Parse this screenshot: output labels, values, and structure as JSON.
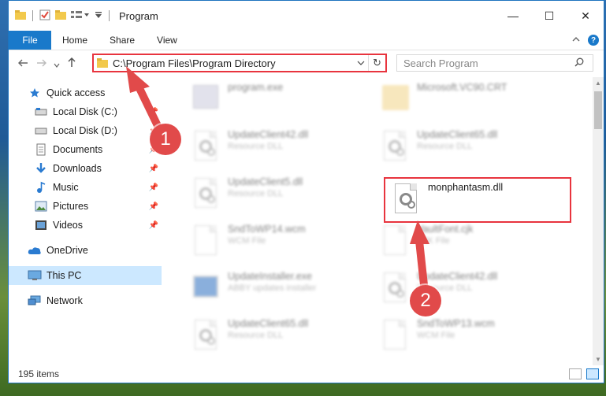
{
  "window": {
    "title": "Program",
    "controls": {
      "minimize": "—",
      "maximize": "☐",
      "close": "✕"
    }
  },
  "ribbon": {
    "file_tab": "File",
    "tabs": [
      "Home",
      "Share",
      "View"
    ]
  },
  "address_bar": {
    "path": "C:\\Program Files\\Program Directory"
  },
  "search": {
    "placeholder": "Search Program"
  },
  "sidebar": {
    "items": [
      {
        "label": "Quick access",
        "icon": "star-icon"
      },
      {
        "label": "Local Disk (C:)",
        "icon": "drive-icon"
      },
      {
        "label": "Local Disk (D:)",
        "icon": "drive-icon"
      },
      {
        "label": "Documents",
        "icon": "documents-icon"
      },
      {
        "label": "Downloads",
        "icon": "download-icon"
      },
      {
        "label": "Music",
        "icon": "music-icon"
      },
      {
        "label": "Pictures",
        "icon": "pictures-icon"
      },
      {
        "label": "Videos",
        "icon": "videos-icon"
      },
      {
        "label": "OneDrive",
        "icon": "cloud-icon"
      },
      {
        "label": "This PC",
        "icon": "computer-icon"
      },
      {
        "label": "Network",
        "icon": "network-icon"
      }
    ]
  },
  "files": [
    {
      "name": "program.exe",
      "type": ""
    },
    {
      "name": "Microsoft.VC90.CRT",
      "type": ""
    },
    {
      "name": "UpdateClient42.dll",
      "type": "Resource DLL"
    },
    {
      "name": "UpdateClient65.dll",
      "type": "Resource DLL"
    },
    {
      "name": "UpdateClient5.dll",
      "type": "Resource DLL"
    },
    {
      "name": "monphantasm.dll",
      "type": ""
    },
    {
      "name": "SndToWP14.wcm",
      "type": "WCM File"
    },
    {
      "name": "VaultFont.cjk",
      "type": "CJK File"
    },
    {
      "name": "UpdateInstaller.exe",
      "type": "ABBY updates installer"
    },
    {
      "name": "UpdateClient42.dll",
      "type": "Resource DLL"
    },
    {
      "name": "UpdateClient65.dll",
      "type": "Resource DLL"
    },
    {
      "name": "SndToWP13.wcm",
      "type": "WCM File"
    }
  ],
  "status": {
    "item_count": "195 items"
  },
  "annotations": {
    "step1": "1",
    "step2": "2"
  },
  "colors": {
    "accent": "#1979ca",
    "highlight": "#e8343e",
    "badge": "#e14a4a"
  }
}
